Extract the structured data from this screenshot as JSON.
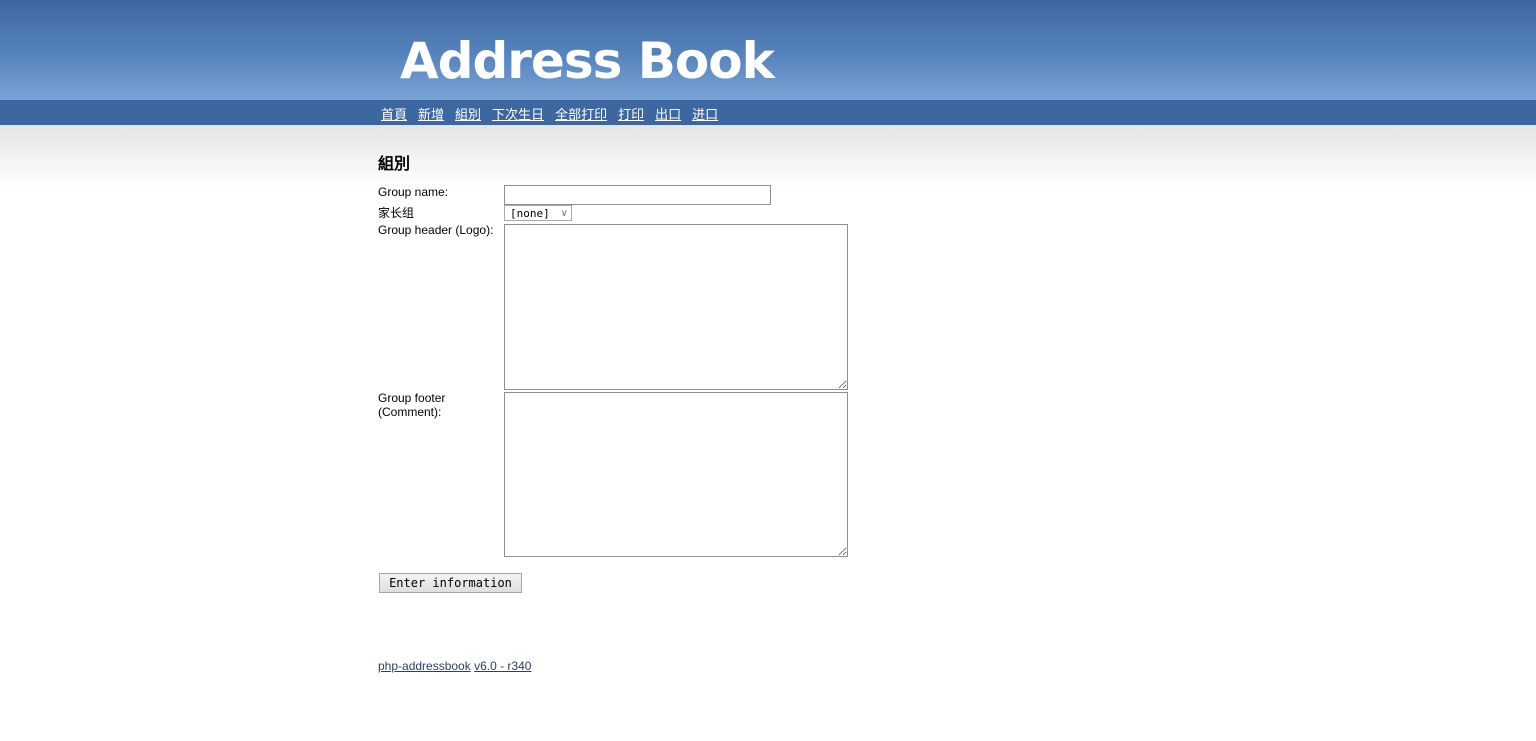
{
  "header": {
    "logo_text": "Address Book"
  },
  "nav": {
    "items": [
      "首頁",
      "新增",
      "組別",
      "下次生日",
      "全部打印",
      "打印",
      "出口",
      "进口"
    ]
  },
  "page": {
    "title": "組別"
  },
  "form": {
    "group_name_label": "Group name:",
    "group_name_value": "",
    "parent_group_label": "家长组",
    "parent_group_selected": "[none]",
    "header_label": "Group header (Logo):",
    "header_value": "",
    "footer_label": "Group footer (Comment):",
    "footer_value": "",
    "submit_label": "Enter information"
  },
  "footer": {
    "app_link": "php-addressbook",
    "version_link": "v6.0 - r340"
  },
  "colors": {
    "header_blue": "#3d67a1",
    "nav_link": "#ffffff",
    "footer_link": "#2a3f6a"
  }
}
